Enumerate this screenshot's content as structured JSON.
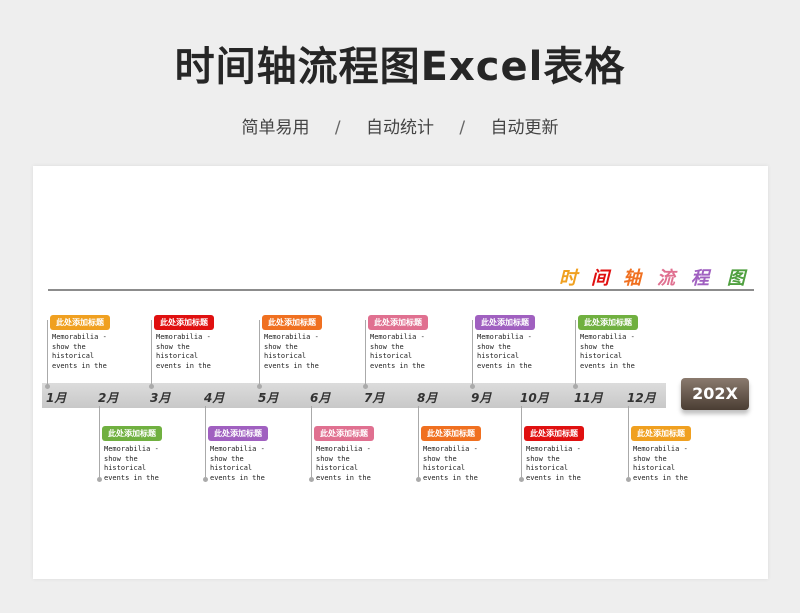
{
  "page": {
    "title": "时间轴流程图Excel表格",
    "subtitle": [
      "简单易用",
      "/",
      "自动统计",
      "/",
      "自动更新"
    ]
  },
  "timeline": {
    "title_chars": [
      {
        "char": "时",
        "color": "#f0a020"
      },
      {
        "char": "间",
        "color": "#e01010"
      },
      {
        "char": "轴",
        "color": "#f07020"
      },
      {
        "char": "流",
        "color": "#e07090"
      },
      {
        "char": "程",
        "color": "#a060c0"
      },
      {
        "char": "图",
        "color": "#50a040"
      }
    ],
    "year_badge": "202X",
    "months": [
      "1月",
      "2月",
      "3月",
      "4月",
      "5月",
      "6月",
      "7月",
      "8月",
      "9月",
      "10月",
      "11月",
      "12月"
    ],
    "events": [
      {
        "month": "1月",
        "position": "above",
        "tag": "此处添加标题",
        "tag_color": "#f0a020",
        "description": "Memorabilia - show the historical events in the"
      },
      {
        "month": "2月",
        "position": "below",
        "tag": "此处添加标题",
        "tag_color": "#70b040",
        "description": "Memorabilia - show the historical events in the"
      },
      {
        "month": "3月",
        "position": "above",
        "tag": "此处添加标题",
        "tag_color": "#e01010",
        "description": "Memorabilia - show the historical events in the"
      },
      {
        "month": "4月",
        "position": "below",
        "tag": "此处添加标题",
        "tag_color": "#a060c0",
        "description": "Memorabilia - show the historical events in the"
      },
      {
        "month": "5月",
        "position": "above",
        "tag": "此处添加标题",
        "tag_color": "#f07020",
        "description": "Memorabilia - show the historical events in the"
      },
      {
        "month": "6月",
        "position": "below",
        "tag": "此处添加标题",
        "tag_color": "#e07090",
        "description": "Memorabilia - show the historical events in the"
      },
      {
        "month": "7月",
        "position": "above",
        "tag": "此处添加标题",
        "tag_color": "#e07090",
        "description": "Memorabilia - show the historical events in the"
      },
      {
        "month": "8月",
        "position": "below",
        "tag": "此处添加标题",
        "tag_color": "#f07020",
        "description": "Memorabilia - show the historical events in the"
      },
      {
        "month": "9月",
        "position": "above",
        "tag": "此处添加标题",
        "tag_color": "#a060c0",
        "description": "Memorabilia - show the historical events in the"
      },
      {
        "month": "10月",
        "position": "below",
        "tag": "此处添加标题",
        "tag_color": "#e01010",
        "description": "Memorabilia - show the historical events in the"
      },
      {
        "month": "11月",
        "position": "above",
        "tag": "此处添加标题",
        "tag_color": "#70b040",
        "description": "Memorabilia - show the historical events in the"
      },
      {
        "month": "12月",
        "position": "below",
        "tag": "此处添加标题",
        "tag_color": "#f0a020",
        "description": "Memorabilia - show the historical events in the"
      }
    ]
  }
}
